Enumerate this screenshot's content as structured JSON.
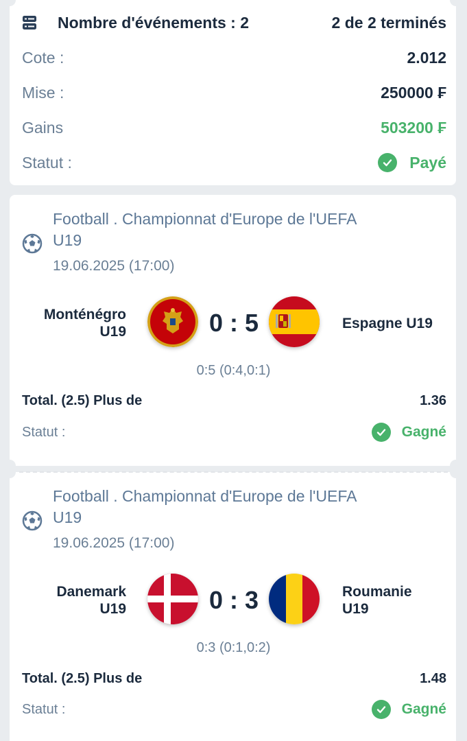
{
  "summary": {
    "events_label": "Nombre d'événements : 2",
    "done_label": "2 de 2 terminés",
    "rows": [
      {
        "label": "Cote :",
        "value": "2.012"
      },
      {
        "label": "Mise :",
        "value": "250000 ₣"
      },
      {
        "label": "Gains",
        "value": "503200 ₣"
      }
    ],
    "status_label": "Statut :",
    "status_value": "Payé",
    "icon": "ticket-list-icon",
    "accent_green": "#48b26b"
  },
  "events": [
    {
      "league_line1": "Football . Championnat d'Europe de l'UEFA",
      "league_line2": "U19",
      "datetime": "19.06.2025 (17:00)",
      "home_line1": "Monténégro",
      "home_line2": "U19",
      "away_line1": "Espagne U19",
      "away_line2": "",
      "score": "0 : 5",
      "period_score": "0:5 (0:4,0:1)",
      "bet_label": "Total. (2.5) Plus de",
      "bet_odds": "1.36",
      "status_label": "Statut :",
      "status_value": "Gagné",
      "home_flag": "montenegro-flag",
      "away_flag": "spain-flag"
    },
    {
      "league_line1": "Football . Championnat d'Europe de l'UEFA",
      "league_line2": "U19",
      "datetime": "19.06.2025 (17:00)",
      "home_line1": "Danemark",
      "home_line2": "U19",
      "away_line1": "Roumanie",
      "away_line2": "U19",
      "score": "0 : 3",
      "period_score": "0:3 (0:1,0:2)",
      "bet_label": "Total. (2.5) Plus de",
      "bet_odds": "1.48",
      "status_label": "Statut :",
      "status_value": "Gagné",
      "home_flag": "denmark-flag",
      "away_flag": "romania-flag"
    }
  ]
}
